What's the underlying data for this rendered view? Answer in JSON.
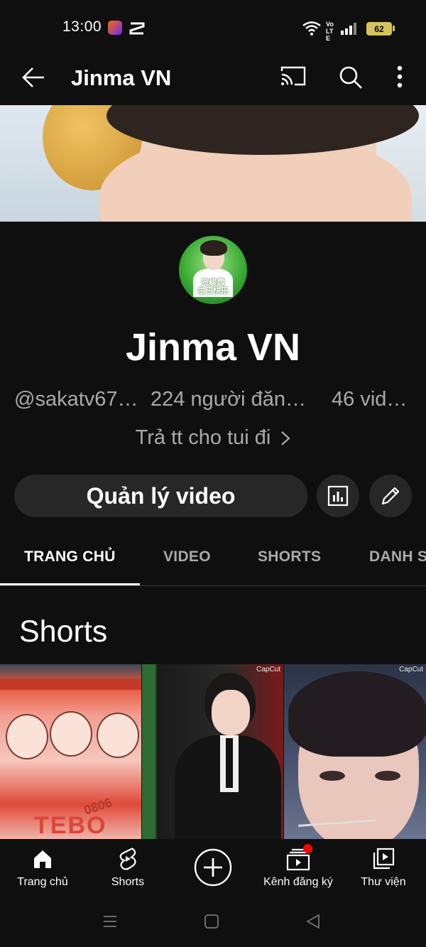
{
  "status_bar": {
    "time": "13:00",
    "battery": "62",
    "network_label": "Vo LTE",
    "icons": [
      "lazada-app-icon",
      "capcut-app-icon",
      "wifi-icon",
      "volte-icon",
      "signal-icon",
      "battery-icon"
    ]
  },
  "app_bar": {
    "title": "Jinma VN",
    "icons": [
      "back-arrow-icon",
      "cast-icon",
      "search-icon",
      "more-vert-icon"
    ]
  },
  "channel": {
    "avatar_text_line1": "贺峻霖",
    "avatar_text_line2": "生日快乐",
    "name": "Jinma VN",
    "handle": "@sakatv67…",
    "subscribers": "224 người đăn…",
    "videos": "46 vid…",
    "description": "Trả tt cho tui đi"
  },
  "actions": {
    "manage_label": "Quản lý video",
    "icons": [
      "analytics-icon",
      "edit-pencil-icon"
    ]
  },
  "tabs": [
    {
      "label": "TRANG CHỦ",
      "active": true
    },
    {
      "label": "VIDEO",
      "active": false
    },
    {
      "label": "SHORTS",
      "active": false
    },
    {
      "label": "DANH S",
      "active": false
    }
  ],
  "shorts": {
    "section_title": "Shorts",
    "watermark": "CapCut",
    "thumb1_text": "TEBO",
    "thumb1_badge": "0806"
  },
  "bottom_nav": [
    {
      "label": "Trang chủ",
      "icon": "home-icon"
    },
    {
      "label": "Shorts",
      "icon": "shorts-icon"
    },
    {
      "label": "",
      "icon": "create-plus-icon"
    },
    {
      "label": "Kênh đăng ký",
      "icon": "subscriptions-icon"
    },
    {
      "label": "Thư viện",
      "icon": "library-icon"
    }
  ],
  "colors": {
    "background": "#0f0f0f",
    "button_bg": "#272727",
    "secondary_text": "#aaaaaa",
    "notification_dot": "#ff0000",
    "battery": "#d5c35a"
  }
}
